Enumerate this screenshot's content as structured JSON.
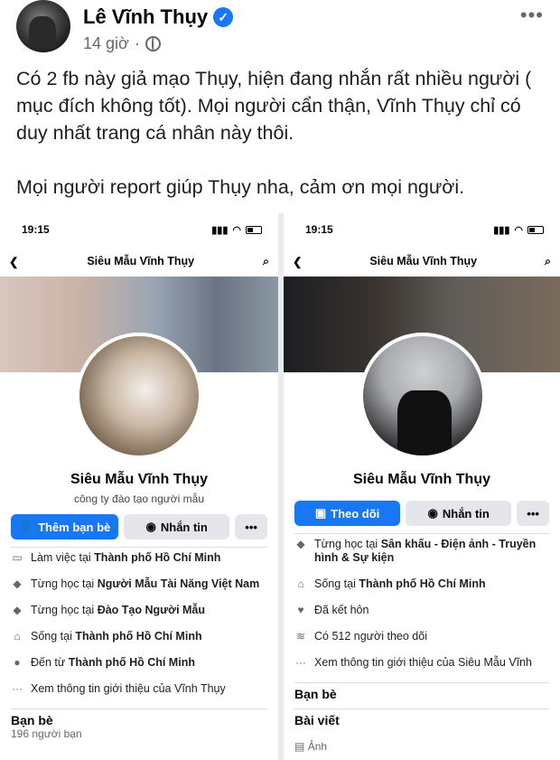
{
  "post": {
    "author": "Lê Vĩnh Thụy",
    "time": "14 giờ",
    "dot": "·",
    "more": "•••",
    "p1": "Có 2 fb này giả mạo Thụy, hiện đang nhắn rất nhiều người ( mục đích không tốt). Mọi người cẩn thận, Vĩnh Thụy chỉ có duy nhất trang cá nhân này thôi.",
    "p2": "Mọi người report giúp Thụy nha, cảm ơn mọi người."
  },
  "left": {
    "time": "19:15",
    "title": "Siêu Mẫu Vĩnh Thụy",
    "name": "Siêu Mẫu Vĩnh Thụy",
    "subtitle": "công ty đào tạo người mẫu",
    "btn1": "Thêm bạn bè",
    "btn2": "Nhắn tin",
    "btn3": "•••",
    "rows": [
      {
        "pre": "Làm việc tại ",
        "b": "Thành phố Hồ Chí Minh"
      },
      {
        "pre": "Từng học tại ",
        "b": "Người Mẫu Tài Năng Việt Nam"
      },
      {
        "pre": "Từng học tại ",
        "b": "Đào Tạo Người Mẫu"
      },
      {
        "pre": "Sống tại ",
        "b": "Thành phố Hồ Chí Minh"
      },
      {
        "pre": "Đến từ ",
        "b": "Thành phố Hồ Chí Minh"
      },
      {
        "pre": "Xem thông tin giới thiệu của Vĩnh Thụy",
        "b": ""
      }
    ],
    "friends": "Bạn bè",
    "friends_count": "196 người bạn"
  },
  "right": {
    "time": "19:15",
    "title": "Siêu Mẫu Vĩnh Thụy",
    "name": "Siêu Mẫu Vĩnh Thụy",
    "btn1": "Theo dõi",
    "btn2": "Nhắn tin",
    "btn3": "•••",
    "rows": [
      {
        "pre": "Từng học tại ",
        "b": "Sân khấu - Điện ảnh - Truyền hình & Sự kiện"
      },
      {
        "pre": "Sống tại ",
        "b": "Thành phố Hồ Chí Minh"
      },
      {
        "pre": "Đã kết hôn",
        "b": ""
      },
      {
        "pre": "Có 512 người theo dõi",
        "b": ""
      },
      {
        "pre": "Xem thông tin giới thiệu của Siêu Mẫu Vĩnh",
        "b": ""
      }
    ],
    "friends": "Bạn bè",
    "posts": "Bài viết",
    "photos": "Ảnh"
  },
  "colors": {
    "accent": "#1877f2",
    "muted": "#65676b"
  }
}
